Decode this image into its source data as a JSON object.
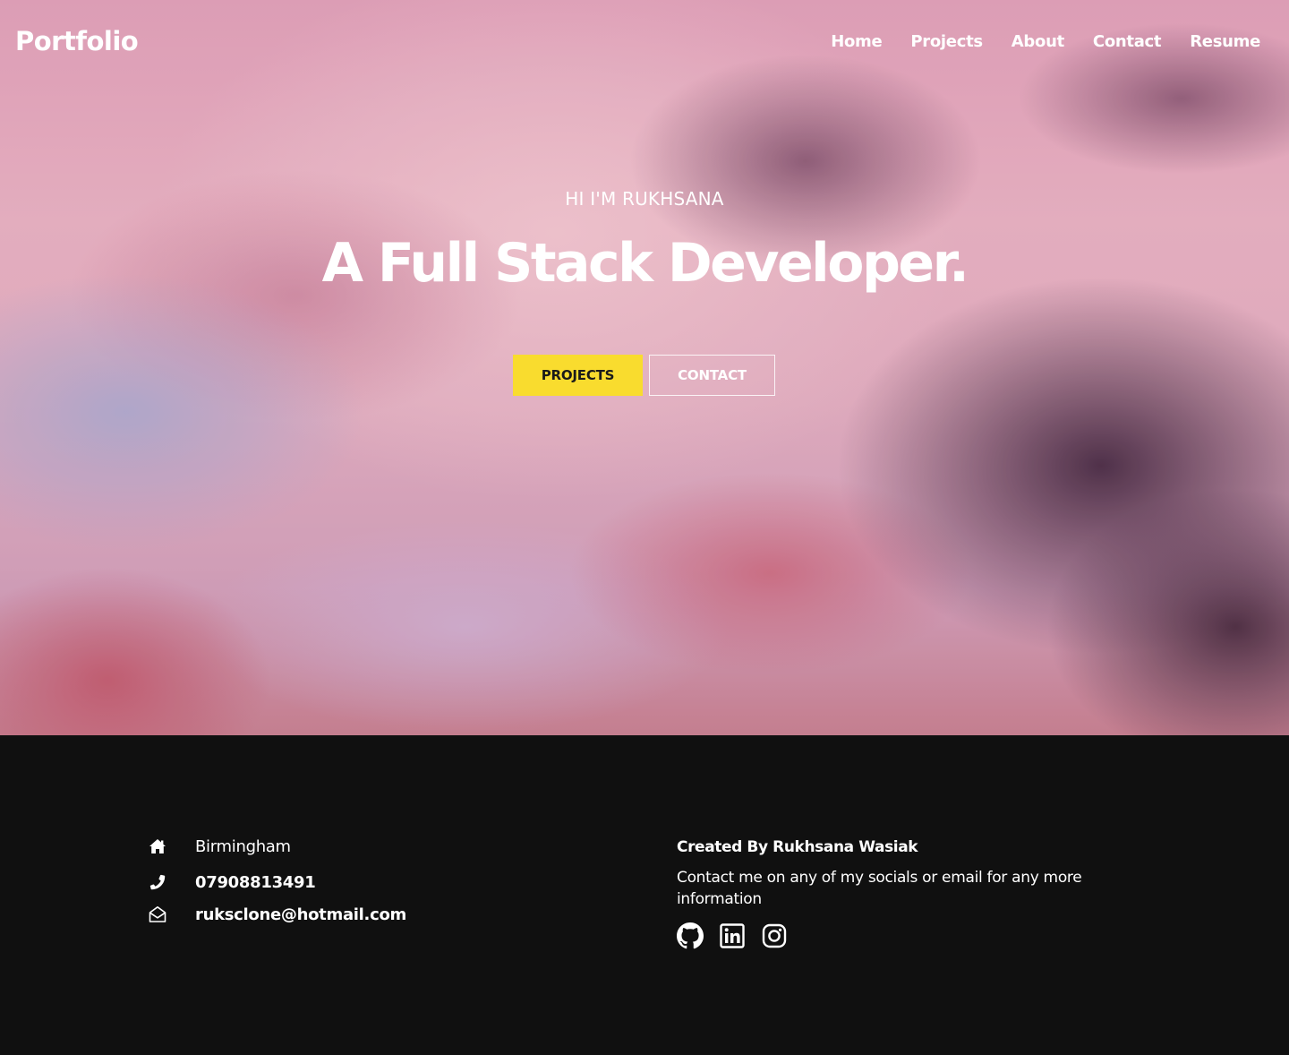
{
  "navbar": {
    "brand": "Portfolio",
    "links": [
      {
        "label": "Home"
      },
      {
        "label": "Projects"
      },
      {
        "label": "About"
      },
      {
        "label": "Contact"
      },
      {
        "label": "Resume"
      }
    ]
  },
  "hero": {
    "greeting": "HI I'M RUKHSANA",
    "title": "A Full Stack Developer.",
    "buttons": {
      "primary_label": "PROJECTS",
      "secondary_label": "CONTACT"
    }
  },
  "footer": {
    "contact": {
      "location": "Birmingham",
      "phone": "07908813491",
      "email": "ruksclone@hotmail.com"
    },
    "created_by": "Created By Rukhsana Wasiak",
    "message": "Contact me on any of my socials or email for any more information",
    "socials": [
      {
        "icon": "github-icon"
      },
      {
        "icon": "linkedin-icon"
      },
      {
        "icon": "instagram-icon"
      }
    ]
  },
  "colors": {
    "accent": "#f9dc2e",
    "footer_bg": "#101010",
    "text": "#ffffff"
  }
}
